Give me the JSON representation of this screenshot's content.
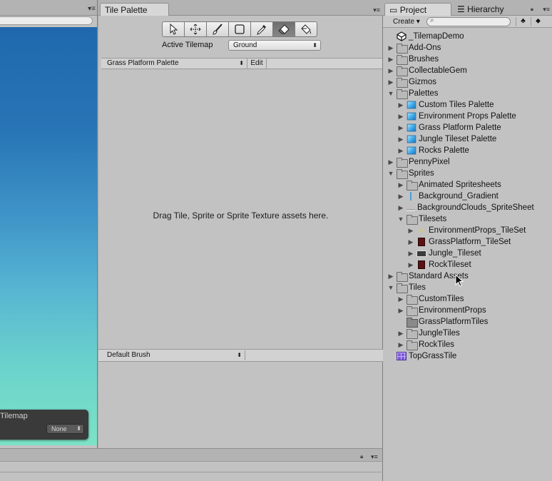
{
  "scene": {
    "overlay_title": "Tilemap",
    "overlay_select": "None"
  },
  "palette": {
    "tab_label": "Tile Palette",
    "active_tilemap_label": "Active Tilemap",
    "active_tilemap_value": "Ground",
    "palette_select": "Grass Platform Palette",
    "edit_label": "Edit",
    "drop_message": "Drag Tile, Sprite or Sprite Texture assets here.",
    "brush_select": "Default Brush",
    "tools": [
      {
        "name": "select-tool",
        "icon": "arrow-icon",
        "active": false
      },
      {
        "name": "move-tool",
        "icon": "move-icon",
        "active": false
      },
      {
        "name": "paint-tool",
        "icon": "brush-icon",
        "active": false
      },
      {
        "name": "box-fill-tool",
        "icon": "box-icon",
        "active": false
      },
      {
        "name": "picker-tool",
        "icon": "eyedropper-icon",
        "active": false
      },
      {
        "name": "erase-tool",
        "icon": "eraser-icon",
        "active": true
      },
      {
        "name": "fill-tool",
        "icon": "bucket-icon",
        "active": false
      }
    ]
  },
  "project": {
    "tab_project": "Project",
    "tab_hierarchy": "Hierarchy",
    "create_label": "Create",
    "tree": [
      {
        "label": "_TilemapDemo",
        "icon": "unity",
        "depth": 0,
        "fold": ""
      },
      {
        "label": "Add-Ons",
        "icon": "folder",
        "depth": 0,
        "fold": "▶"
      },
      {
        "label": "Brushes",
        "icon": "folder",
        "depth": 0,
        "fold": "▶"
      },
      {
        "label": "CollectableGem",
        "icon": "folder",
        "depth": 0,
        "fold": "▶"
      },
      {
        "label": "Gizmos",
        "icon": "folder",
        "depth": 0,
        "fold": "▶"
      },
      {
        "label": "Palettes",
        "icon": "folder",
        "depth": 0,
        "fold": "▼"
      },
      {
        "label": "Custom Tiles Palette",
        "icon": "cube",
        "depth": 1,
        "fold": "▶"
      },
      {
        "label": "Environment Props Palette",
        "icon": "cube",
        "depth": 1,
        "fold": "▶"
      },
      {
        "label": "Grass Platform Palette",
        "icon": "cube",
        "depth": 1,
        "fold": "▶"
      },
      {
        "label": "Jungle Tileset Palette",
        "icon": "cube",
        "depth": 1,
        "fold": "▶"
      },
      {
        "label": "Rocks Palette",
        "icon": "cube",
        "depth": 1,
        "fold": "▶"
      },
      {
        "label": "PennyPixel",
        "icon": "folder",
        "depth": 0,
        "fold": "▶"
      },
      {
        "label": "Sprites",
        "icon": "folder",
        "depth": 0,
        "fold": "▼"
      },
      {
        "label": "Animated Spritesheets",
        "icon": "folder",
        "depth": 1,
        "fold": "▶"
      },
      {
        "label": "Background_Gradient",
        "icon": "sprite-thin",
        "depth": 1,
        "fold": "▶"
      },
      {
        "label": "BackgroundClouds_SpriteSheet",
        "icon": "sprite-cloud",
        "depth": 1,
        "fold": "▶"
      },
      {
        "label": "Tilesets",
        "icon": "folder",
        "depth": 1,
        "fold": "▼"
      },
      {
        "label": "EnvironmentProps_TileSet",
        "icon": "sprite-star",
        "depth": 2,
        "fold": "▶"
      },
      {
        "label": "GrassPlatform_TileSet",
        "icon": "sprite-red",
        "depth": 2,
        "fold": "▶"
      },
      {
        "label": "Jungle_Tileset",
        "icon": "sprite-jungle",
        "depth": 2,
        "fold": "▶"
      },
      {
        "label": "RockTileset",
        "icon": "sprite-red",
        "depth": 2,
        "fold": "▶"
      },
      {
        "label": "Standard Assets",
        "icon": "folder",
        "depth": 0,
        "fold": "▶"
      },
      {
        "label": "Tiles",
        "icon": "folder",
        "depth": 0,
        "fold": "▼"
      },
      {
        "label": "CustomTiles",
        "icon": "folder",
        "depth": 1,
        "fold": "▶"
      },
      {
        "label": "EnvironmentProps",
        "icon": "folder",
        "depth": 1,
        "fold": "▶"
      },
      {
        "label": "GrassPlatformTiles",
        "icon": "grayfolder",
        "depth": 1,
        "fold": ""
      },
      {
        "label": "JungleTiles",
        "icon": "folder",
        "depth": 1,
        "fold": "▶"
      },
      {
        "label": "RockTiles",
        "icon": "folder",
        "depth": 1,
        "fold": "▶"
      },
      {
        "label": "TopGrassTile",
        "icon": "tilemap",
        "depth": 0,
        "fold": ""
      }
    ]
  },
  "colors": {
    "panel_bg": "#c2c2c2",
    "tab_bg": "#b3b3b3",
    "sky_top": "#1f68ad",
    "sky_bottom": "#7ce3c6"
  }
}
